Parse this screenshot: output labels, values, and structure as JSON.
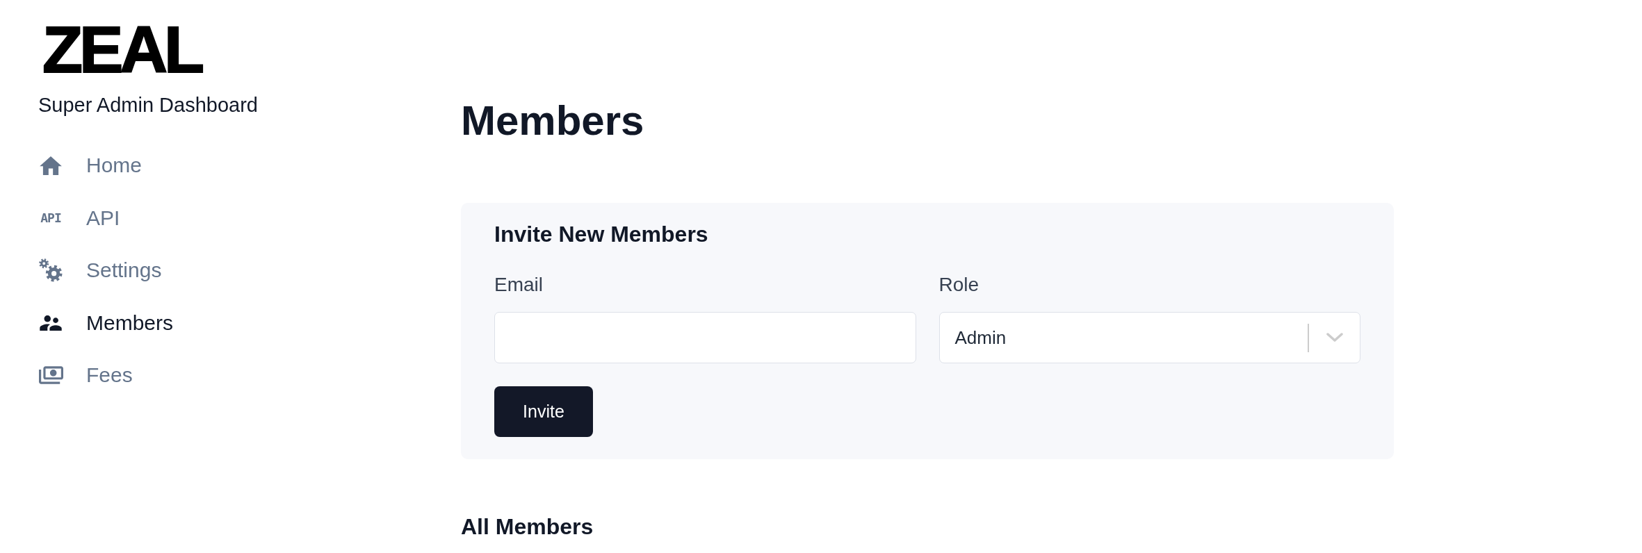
{
  "logo": "ZEAL",
  "subtitle": "Super Admin Dashboard",
  "sidebar": {
    "items": [
      {
        "label": "Home",
        "selected": false
      },
      {
        "label": "API",
        "selected": false,
        "icon_text": "API"
      },
      {
        "label": "Settings",
        "selected": false
      },
      {
        "label": "Members",
        "selected": true
      },
      {
        "label": "Fees",
        "selected": false
      }
    ]
  },
  "page": {
    "title": "Members"
  },
  "invite_card": {
    "title": "Invite New Members",
    "fields": [
      {
        "kind": "text",
        "label": "Email"
      },
      {
        "kind": "select",
        "label": "Role",
        "value": "Admin"
      }
    ],
    "button": "Invite"
  },
  "members_section": {
    "title": "All Members"
  }
}
